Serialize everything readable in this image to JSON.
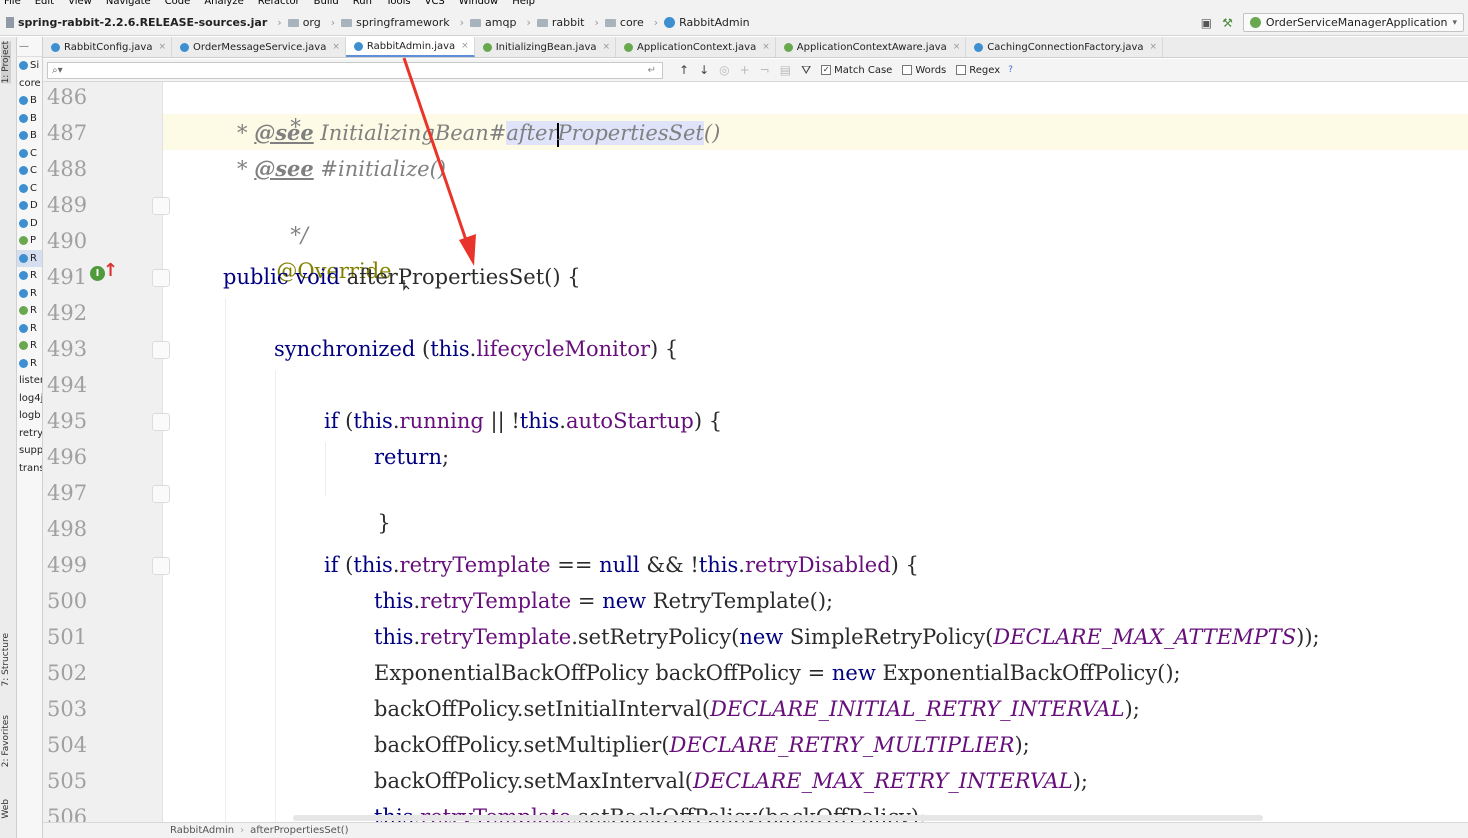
{
  "menu": {
    "items": [
      "File",
      "Edit",
      "View",
      "Navigate",
      "Code",
      "Analyze",
      "Refactor",
      "Build",
      "Run",
      "Tools",
      "VCS",
      "Window",
      "Help"
    ]
  },
  "nav": {
    "root": "spring-rabbit-2.2.6.RELEASE-sources.jar",
    "crumbs": [
      "org",
      "springframework",
      "amqp",
      "rabbit",
      "core",
      "RabbitAdmin"
    ],
    "run_config": "OrderServiceManagerApplication"
  },
  "left_strip": {
    "project": "1: Project",
    "structure": "7: Structure",
    "favorites": "2: Favorites",
    "web": "Web"
  },
  "project_tree": {
    "top": "Si",
    "items": [
      {
        "label": "core",
        "icon": "none"
      },
      {
        "label": "B",
        "icon": "class"
      },
      {
        "label": "B",
        "icon": "class"
      },
      {
        "label": "B",
        "icon": "class"
      },
      {
        "label": "C",
        "icon": "class"
      },
      {
        "label": "C",
        "icon": "class"
      },
      {
        "label": "C",
        "icon": "class"
      },
      {
        "label": "D",
        "icon": "class"
      },
      {
        "label": "D",
        "icon": "class"
      },
      {
        "label": "P",
        "icon": "interface"
      },
      {
        "label": "R",
        "icon": "class"
      },
      {
        "label": "R",
        "icon": "class"
      },
      {
        "label": "R",
        "icon": "class"
      },
      {
        "label": "R",
        "icon": "interface"
      },
      {
        "label": "R",
        "icon": "class"
      },
      {
        "label": "R",
        "icon": "interface"
      },
      {
        "label": "R",
        "icon": "class"
      },
      {
        "label": "listen",
        "icon": "none"
      },
      {
        "label": "log4j",
        "icon": "none"
      },
      {
        "label": "logb",
        "icon": "none"
      },
      {
        "label": "retry",
        "icon": "none"
      },
      {
        "label": "supp",
        "icon": "none"
      },
      {
        "label": "trans",
        "icon": "none"
      }
    ]
  },
  "tabs": [
    {
      "label": "RabbitConfig.java",
      "icon": "class",
      "active": false
    },
    {
      "label": "OrderMessageService.java",
      "icon": "class",
      "active": false
    },
    {
      "label": "RabbitAdmin.java",
      "icon": "class",
      "active": true
    },
    {
      "label": "InitializingBean.java",
      "icon": "interface",
      "active": false
    },
    {
      "label": "ApplicationContext.java",
      "icon": "interface",
      "active": false
    },
    {
      "label": "ApplicationContextAware.java",
      "icon": "interface",
      "active": false
    },
    {
      "label": "CachingConnectionFactory.java",
      "icon": "class",
      "active": false
    }
  ],
  "find": {
    "query": "",
    "match_case_label": "Match Case",
    "match_case": true,
    "words_label": "Words",
    "words": false,
    "regex_label": "Regex",
    "regex": false,
    "help": "?"
  },
  "editor": {
    "line_numbers": [
      "486",
      "487",
      "488",
      "489",
      "490",
      "491",
      "492",
      "493",
      "494",
      "495",
      "496",
      "497",
      "498",
      "499",
      "500",
      "501",
      "502",
      "503",
      "504",
      "505",
      "506"
    ],
    "code": {
      "l486": "*",
      "l487_star": "*",
      "l487_tag": "@see",
      "l487_a": "InitializingBean#",
      "l487_m1": "after",
      "l487_m2": "PropertiesSet",
      "l487_b": "()",
      "l488_star": "*",
      "l488_tag": "@see",
      "l488_a": "#initialize()",
      "l489": "*/",
      "l490": "@Override",
      "l491_kw": "public void",
      "l491_a": " afterPropertiesSet() {",
      "l493_kw": "synchronized",
      "l493_a": " (",
      "l493_this": "this",
      "l493_dot": ".",
      "l493_fld": "lifecycleMonitor",
      "l493_b": ") {",
      "l495_kw": "if",
      "l495_a": " (",
      "l495_this": "this",
      "l495_dot": ".",
      "l495_fld": "running",
      "l495_b": " || !",
      "l495_this2": "this",
      "l495_dot2": ".",
      "l495_fld2": "autoStartup",
      "l495_c": ") {",
      "l496_kw": "return",
      "l496_a": ";",
      "l497": "}",
      "l499_kw": "if",
      "l499_a": " (",
      "l499_this": "this",
      "l499_dot": ".",
      "l499_fld": "retryTemplate",
      "l499_b": " == ",
      "l499_null": "null",
      "l499_c": " && !",
      "l499_this2": "this",
      "l499_dot2": ".",
      "l499_fld2": "retryDisabled",
      "l499_d": ") {",
      "l500_this": "this",
      "l500_dot": ".",
      "l500_fld": "retryTemplate",
      "l500_a": " = ",
      "l500_new": "new",
      "l500_b": " RetryTemplate();",
      "l501_this": "this",
      "l501_dot": ".",
      "l501_fld": "retryTemplate",
      "l501_a": ".setRetryPolicy(",
      "l501_new": "new",
      "l501_b": " SimpleRetryPolicy(",
      "l501_const": "DECLARE_MAX_ATTEMPTS",
      "l501_c": "));",
      "l502_a": "ExponentialBackOffPolicy backOffPolicy = ",
      "l502_new": "new",
      "l502_b": " ExponentialBackOffPolicy();",
      "l503_a": "backOffPolicy.setInitialInterval(",
      "l503_const": "DECLARE_INITIAL_RETRY_INTERVAL",
      "l503_b": ");",
      "l504_a": "backOffPolicy.setMultiplier(",
      "l504_const": "DECLARE_RETRY_MULTIPLIER",
      "l504_b": ");",
      "l505_a": "backOffPolicy.setMaxInterval(",
      "l505_const": "DECLARE_MAX_RETRY_INTERVAL",
      "l505_b": ");",
      "l506_this": "this",
      "l506_dot": ".",
      "l506_fld": "retryTemplate",
      "l506_a": ".setBackOffPolicy(backOffPolicy);"
    },
    "gutter_marker": "I"
  },
  "status": {
    "crumbs": [
      "RabbitAdmin",
      "afterPropertiesSet()"
    ]
  },
  "colors": {
    "keyword": "#000080",
    "field": "#660e7a",
    "comment": "#808080",
    "annotation": "#808000",
    "arrow": "#e8342a",
    "current_line": "#fdfbe6",
    "match_highlight": "#dfe4fb"
  }
}
